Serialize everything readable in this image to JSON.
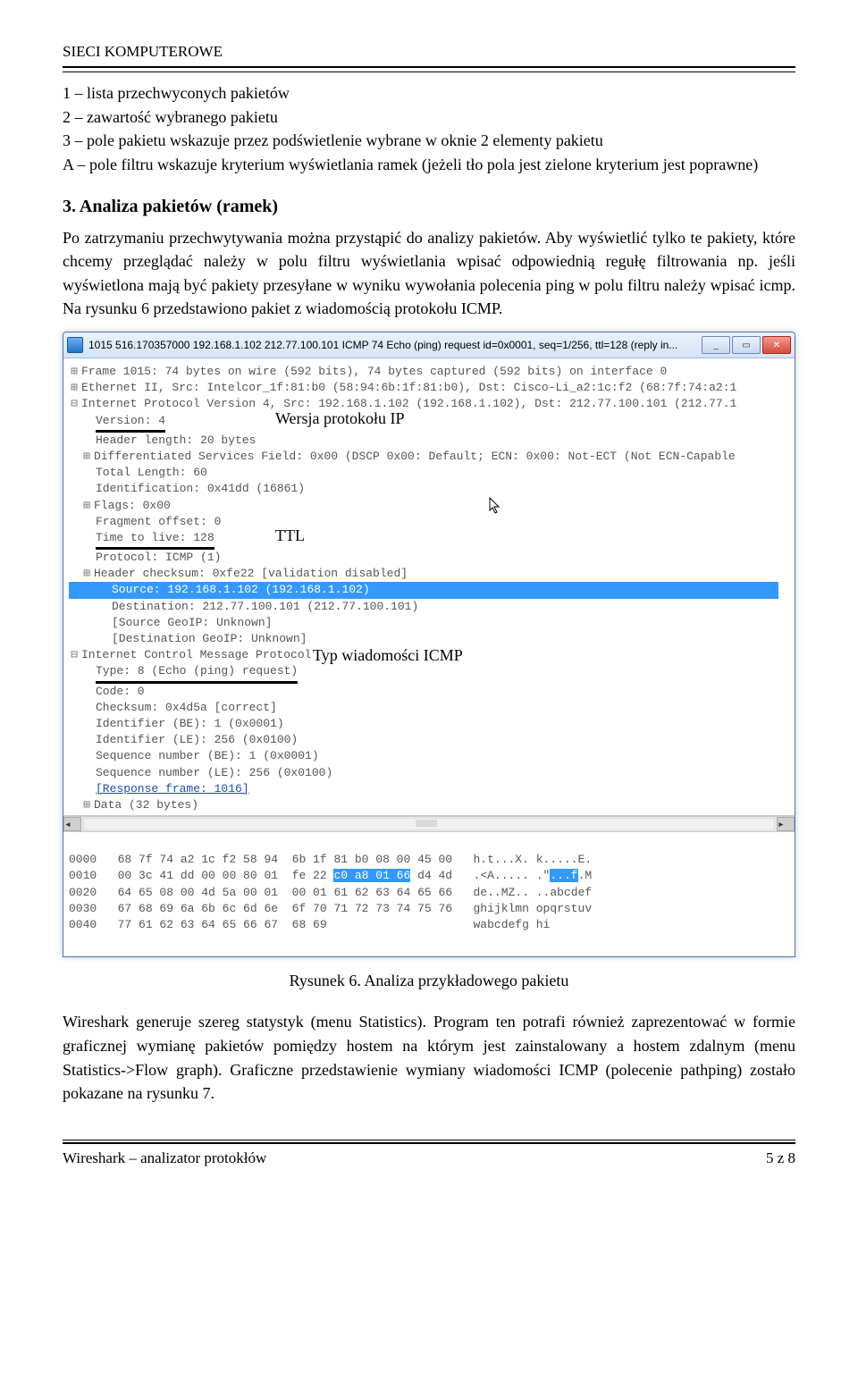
{
  "header": {
    "title": "SIECI KOMPUTEROWE"
  },
  "intro": {
    "line1": "1 – lista przechwyconych pakietów",
    "line2": "2 – zawartość wybranego pakietu",
    "line3": "3 – pole pakietu wskazuje przez podświetlenie wybrane w oknie 2 elementy pakietu",
    "line4": "A – pole filtru wskazuje kryterium wyświetlania ramek (jeżeli tło pola jest zielone kryterium jest poprawne)"
  },
  "section3": {
    "title": "3. Analiza pakietów (ramek)",
    "para": "Po zatrzymaniu przechwytywania można przystąpić do analizy pakietów. Aby wyświetlić tylko te pakiety, które chcemy przeglądać należy w polu filtru wyświetlania wpisać odpowiednią regułę filtrowania np. jeśli wyświetlona mają być pakiety przesyłane w wyniku wywołania polecenia ping w polu filtru należy wpisać icmp. Na rysunku 6 przedstawiono pakiet z wiadomością protokołu ICMP."
  },
  "window": {
    "title": "1015 516.170357000 192.168.1.102 212.77.100.101 ICMP 74 Echo (ping) request  id=0x0001, seq=1/256, ttl=128 (reply in...",
    "min": "_",
    "max": "▭",
    "close": "✕"
  },
  "tree": {
    "frame": "Frame 1015: 74 bytes on wire (592 bits), 74 bytes captured (592 bits) on interface 0",
    "eth": "Ethernet II, Src: Intelcor_1f:81:b0 (58:94:6b:1f:81:b0), Dst: Cisco-Li_a2:1c:f2 (68:7f:74:a2:1",
    "ip": "Internet Protocol Version 4, Src: 192.168.1.102 (192.168.1.102), Dst: 212.77.100.101 (212.77.1",
    "version": "Version: 4",
    "hdrlen": "Header length: 20 bytes",
    "dsf": "Differentiated Services Field: 0x00 (DSCP 0x00: Default; ECN: 0x00: Not-ECT (Not ECN-Capable",
    "totlen": "Total Length: 60",
    "id": "Identification: 0x41dd (16861)",
    "flags": "Flags: 0x00",
    "frag": "Fragment offset: 0",
    "ttl": "Time to live: 128",
    "proto": "Protocol: ICMP (1)",
    "hdrchk": "Header checksum: 0xfe22 [validation disabled]",
    "src": "Source: 192.168.1.102 (192.168.1.102)",
    "dst": "Destination: 212.77.100.101 (212.77.100.101)",
    "srcgeo": "[Source GeoIP: Unknown]",
    "dstgeo": "[Destination GeoIP: Unknown]",
    "icmp": "Internet Control Message Protocol",
    "type": "Type: 8 (Echo (ping) request)",
    "code": "Code: 0",
    "chk": "Checksum: 0x4d5a [correct]",
    "idbe": "Identifier (BE): 1 (0x0001)",
    "idle": "Identifier (LE): 256 (0x0100)",
    "seqbe": "Sequence number (BE): 1 (0x0001)",
    "seqle": "Sequence number (LE): 256 (0x0100)",
    "resp": "[Response frame: 1016]",
    "data": "Data (32 bytes)"
  },
  "hex": {
    "r0": {
      "off": "0000",
      "b": "68 7f 74 a2 1c f2 58 94  6b 1f 81 b0 08 00 45 00",
      "a": "h.t...X. k.....E."
    },
    "r1": {
      "off": "0010",
      "b1": "00 3c 41 dd 00 00 80 01  fe 22 ",
      "hi": "c0 a8 01 66",
      "b2": " d4 4d",
      "a1": ".<A..... .\"",
      "ahi": "...f",
      "a2": ".M"
    },
    "r2": {
      "off": "0020",
      "b": "64 65 08 00 4d 5a 00 01  00 01 61 62 63 64 65 66",
      "a": "de..MZ.. ..abcdef"
    },
    "r3": {
      "off": "0030",
      "b": "67 68 69 6a 6b 6c 6d 6e  6f 70 71 72 73 74 75 76",
      "a": "ghijklmn opqrstuv"
    },
    "r4": {
      "off": "0040",
      "b": "77 61 62 63 64 65 66 67  68 69",
      "a": "wabcdefg hi"
    }
  },
  "annotations": {
    "version": "Wersja protokołu IP",
    "ttl": "TTL",
    "icmp_type": "Typ wiadomości ICMP"
  },
  "caption": "Rysunek 6. Analiza przykładowego pakietu",
  "outro": "Wireshark generuje szereg statystyk (menu Statistics). Program ten potrafi również zaprezentować w formie graficznej wymianę pakietów pomiędzy hostem na którym jest zainstalowany a hostem zdalnym (menu Statistics->Flow graph). Graficzne przedstawienie wymiany wiadomości ICMP (polecenie pathping) zostało pokazane na rysunku 7.",
  "footer": {
    "left": "Wireshark – analizator protokłów",
    "right": "5 z 8"
  }
}
